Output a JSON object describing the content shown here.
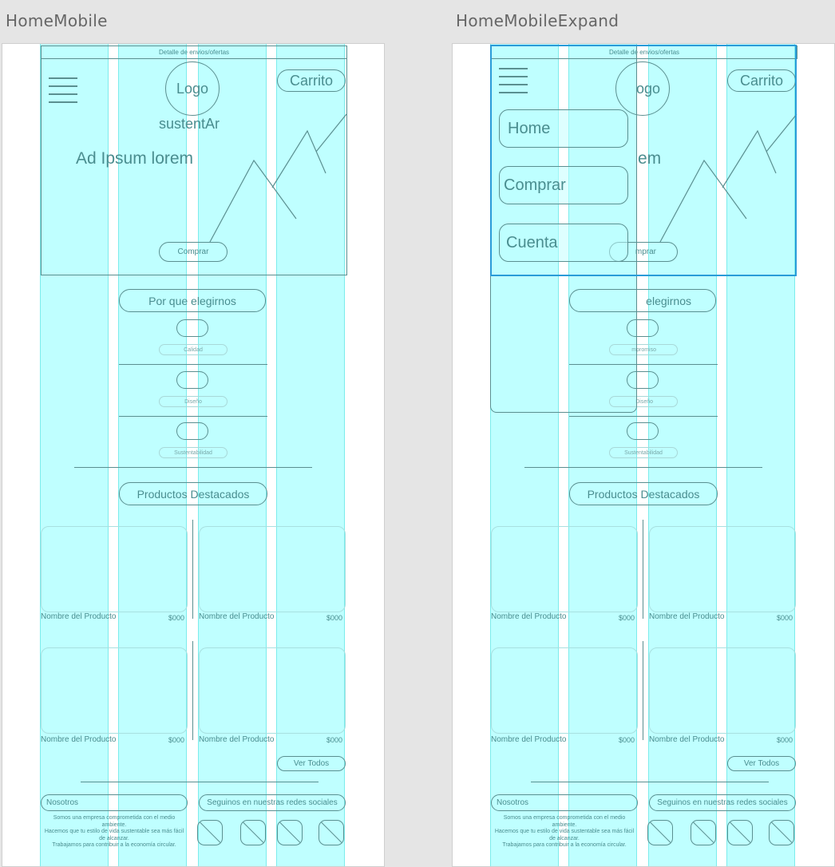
{
  "boards": [
    {
      "title": "HomeMobile",
      "topbar": "Detalle de envios/ofertas",
      "logo": "Logo",
      "brand": "sustentAr",
      "cart": "Carrito",
      "headline": "Ad Ipsum lorem",
      "cta": "Comprar",
      "why_title": "Por que elegirnos",
      "features": [
        "Calidad",
        "Diseño",
        "Sustentabilidad"
      ],
      "products_title": "Productos Destacados",
      "products": [
        {
          "name": "Nombre del Producto",
          "price": "$000"
        },
        {
          "name": "Nombre del Producto",
          "price": "$000"
        },
        {
          "name": "Nombre del Producto",
          "price": "$000"
        },
        {
          "name": "Nombre del Producto",
          "price": "$000"
        }
      ],
      "see_all": "Ver Todos",
      "about_title": "Nosotros",
      "social_title": "Seguinos en nuestras redes sociales",
      "about_lines": [
        "Somos una empresa comprometida con el medio ambiente.",
        "Hacemos que tu estilo de vida sustentable sea más fácil de alcanzar.",
        "Trabajamos para contribuir a la economía circular."
      ],
      "social_icons": [
        "social-icon",
        "social-icon",
        "social-icon",
        "social-icon"
      ]
    },
    {
      "title": "HomeMobileExpand",
      "topbar": "Detalle de envios/ofertas",
      "logo_partial": "ogo",
      "cart": "Carrito",
      "headline_partial": "em",
      "cta_partial": "mprar",
      "why_partial": "elegirnos",
      "features_partial": [
        "mpromiso",
        "Diseño",
        "Sustentabilidad"
      ],
      "menu": [
        "Home",
        "Comprar",
        "Cuenta"
      ],
      "products_title": "Productos Destacados",
      "products": [
        {
          "name": "Nombre del Producto",
          "price": "$000"
        },
        {
          "name": "Nombre del Producto",
          "price": "$000"
        },
        {
          "name": "Nombre del Producto",
          "price": "$000"
        },
        {
          "name": "Nombre del Producto",
          "price": "$000"
        }
      ],
      "see_all": "Ver Todos",
      "about_title": "Nosotros",
      "social_title": "Seguinos en nuestras redes sociales",
      "about_lines": [
        "Somos una empresa comprometida con el medio ambiente.",
        "Hacemos que tu estilo de vida sustentable sea más fácil de alcanzar.",
        "Trabajamos para contribuir a la economía circular."
      ]
    }
  ],
  "colors": {
    "grid_column": "#00ffff",
    "wire": "#5a8f90",
    "selection": "#2a9bd8"
  }
}
